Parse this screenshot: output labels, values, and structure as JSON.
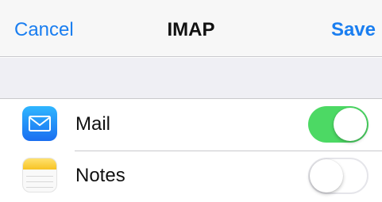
{
  "navbar": {
    "cancel_label": "Cancel",
    "title": "IMAP",
    "save_label": "Save"
  },
  "rows": [
    {
      "label": "Mail",
      "icon": "mail-icon",
      "enabled": true
    },
    {
      "label": "Notes",
      "icon": "notes-icon",
      "enabled": false
    }
  ],
  "colors": {
    "accent": "#1a7ef0",
    "toggle_on": "#4cd964"
  }
}
